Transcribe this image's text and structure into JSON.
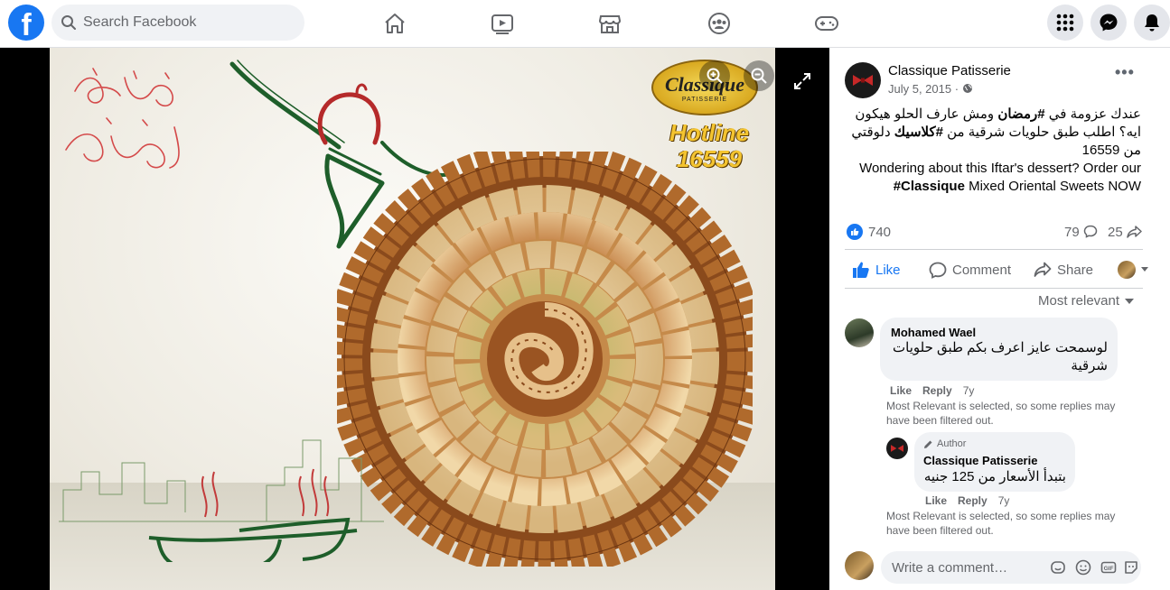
{
  "app": {
    "logo_letter": "f",
    "search_placeholder": "Search Facebook",
    "nav_icons": [
      "home-icon",
      "watch-icon",
      "marketplace-icon",
      "groups-icon",
      "gaming-icon"
    ],
    "right_icons": [
      "menu-grid-icon",
      "messenger-icon",
      "notifications-icon"
    ],
    "colors": {
      "brand": "#1877f2",
      "secondary_text": "#65676b",
      "bubble": "#f0f2f5"
    }
  },
  "photo": {
    "logo_brand": "Classique",
    "logo_sub": "PATISSERIE",
    "hotline_label": "Hotline",
    "hotline_number": "16559",
    "calligraphy": "رمضان مبارك"
  },
  "post": {
    "page_name": "Classique Patisserie",
    "date": "July 5, 2015 · ",
    "text_ar_1": "عندك عزومة في ",
    "text_ar_hashtag1": "#رمضان",
    "text_ar_2": " ومش عارف الحلو هيكون ايه؟ اطلب طبق حلويات شرقية من ",
    "text_ar_hashtag2": "#كلاسيك",
    "text_ar_3": " دلوقتي من 16559",
    "text_en_1": "Wondering about this Iftar's dessert? Order our ",
    "text_en_hashtag": "#Classique",
    "text_en_2": " Mixed Oriental Sweets NOW",
    "likes": "740",
    "comments": "79",
    "shares": "25",
    "actions": {
      "like": "Like",
      "comment": "Comment",
      "share": "Share"
    },
    "sort_label": "Most relevant"
  },
  "comments": [
    {
      "name": "Mohamed Wael",
      "text": "لوسمحت عايز اعرف بكم طبق حلويات شرقية",
      "like": "Like",
      "reply": "Reply",
      "time": "7y",
      "note": "Most Relevant is selected, so some replies may have been filtered out."
    },
    {
      "badge": "Author",
      "name": "Classique Patisserie",
      "text": "بتبدأ الأسعار من 125 جنيه",
      "like": "Like",
      "reply": "Reply",
      "time": "7y",
      "note": "Most Relevant is selected, so some replies may have been filtered out."
    }
  ],
  "composer": {
    "placeholder": "Write a comment…"
  }
}
